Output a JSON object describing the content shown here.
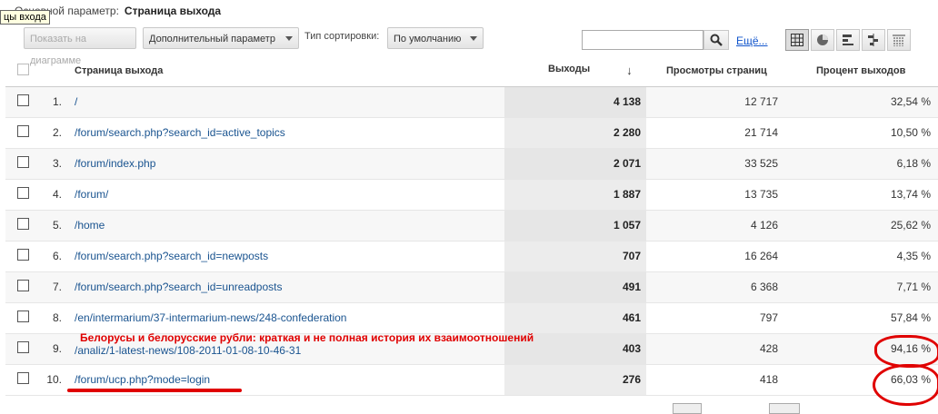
{
  "header": {
    "primary_dimension_label": "Основной параметр:",
    "primary_dimension_value": "Страница выхода",
    "tooltip": "цы входа"
  },
  "controls": {
    "plot_button": "Показать на диаграмме",
    "secondary_dimension": "Дополнительный параметр",
    "sort_label": "Тип сортировки:",
    "sort_value": "По умолчанию",
    "search_placeholder": "",
    "more_link": "Ещё..."
  },
  "table": {
    "columns": {
      "page": "Страница выхода",
      "exits": "Выходы",
      "pageviews": "Просмотры страниц",
      "exit_rate": "Процент выходов"
    },
    "rows": [
      {
        "index": "1.",
        "page": "/",
        "exits": "4 138",
        "pageviews": "12 717",
        "exit_rate": "32,54 %"
      },
      {
        "index": "2.",
        "page": "/forum/search.php?search_id=active_topics",
        "exits": "2 280",
        "pageviews": "21 714",
        "exit_rate": "10,50 %"
      },
      {
        "index": "3.",
        "page": "/forum/index.php",
        "exits": "2 071",
        "pageviews": "33 525",
        "exit_rate": "6,18 %"
      },
      {
        "index": "4.",
        "page": "/forum/",
        "exits": "1 887",
        "pageviews": "13 735",
        "exit_rate": "13,74 %"
      },
      {
        "index": "5.",
        "page": "/home",
        "exits": "1 057",
        "pageviews": "4 126",
        "exit_rate": "25,62 %"
      },
      {
        "index": "6.",
        "page": "/forum/search.php?search_id=newposts",
        "exits": "707",
        "pageviews": "16 264",
        "exit_rate": "4,35 %"
      },
      {
        "index": "7.",
        "page": "/forum/search.php?search_id=unreadposts",
        "exits": "491",
        "pageviews": "6 368",
        "exit_rate": "7,71 %"
      },
      {
        "index": "8.",
        "page": "/en/intermarium/37-intermarium-news/248-confederation",
        "exits": "461",
        "pageviews": "797",
        "exit_rate": "57,84 %"
      },
      {
        "index": "9.",
        "page": "/analiz/1-latest-news/108-2011-01-08-10-46-31",
        "exits": "403",
        "pageviews": "428",
        "exit_rate": "94,16 %"
      },
      {
        "index": "10.",
        "page": "/forum/ucp.php?mode=login",
        "exits": "276",
        "pageviews": "418",
        "exit_rate": "66,03 %"
      }
    ]
  },
  "annotation": {
    "text": "Белорусы и белорусские рубли: краткая и не полная история их взаимоотношений",
    "color": "#e00000"
  }
}
